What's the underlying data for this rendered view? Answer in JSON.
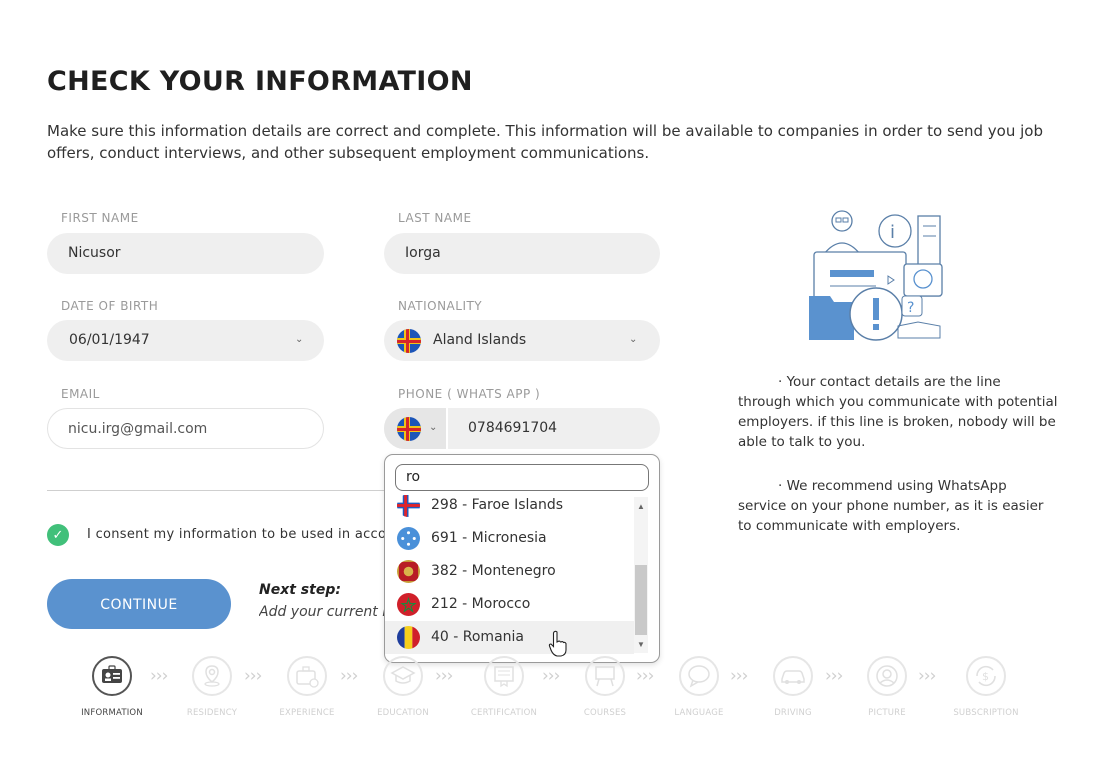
{
  "page": {
    "title": "CHECK YOUR INFORMATION",
    "intro": "Make sure this information details are correct and complete. This information will be available to companies in order to send you job offers, conduct interviews, and other subsequent employment communications."
  },
  "form": {
    "first_name": {
      "label": "FIRST NAME",
      "value": "Nicusor"
    },
    "last_name": {
      "label": "LAST NAME",
      "value": "Iorga"
    },
    "dob": {
      "label": "DATE OF BIRTH",
      "value": "06/01/1947"
    },
    "nationality": {
      "label": "NATIONALITY",
      "value": "Aland Islands"
    },
    "email": {
      "label": "EMAIL",
      "value": "nicu.irg@gmail.com"
    },
    "phone": {
      "label": "PHONE ( WHATS APP )",
      "value": "0784691704"
    },
    "consent": "I consent my information to be used in accordance",
    "continue_label": "CONTINUE",
    "next_step_title": "Next step:",
    "next_step_text": "Add your current residency"
  },
  "country_dropdown": {
    "search_value": "ro",
    "items": [
      {
        "label": "298 - Faroe Islands",
        "flag": "faroe-flag"
      },
      {
        "label": "691 - Micronesia",
        "flag": "micronesia-flag"
      },
      {
        "label": "382 - Montenegro",
        "flag": "montenegro-flag"
      },
      {
        "label": "212 - Morocco",
        "flag": "morocco-flag"
      },
      {
        "label": "40 - Romania",
        "flag": "romania-flag"
      }
    ]
  },
  "sidebar": {
    "note1": "· Your contact details are the line through which you communicate with potential employers. if this line is broken, nobody will be able to talk to you.",
    "note2": "· We recommend using WhatsApp service on your phone number, as it is easier to communicate with employers."
  },
  "steps": [
    {
      "label": "INFORMATION",
      "icon": "id-card-icon",
      "active": true
    },
    {
      "label": "RESIDENCY",
      "icon": "location-pin-icon",
      "active": false
    },
    {
      "label": "EXPERIENCE",
      "icon": "briefcase-icon",
      "active": false
    },
    {
      "label": "EDUCATION",
      "icon": "graduation-cap-icon",
      "active": false
    },
    {
      "label": "CERTIFICATION",
      "icon": "certificate-icon",
      "active": false
    },
    {
      "label": "COURSES",
      "icon": "easel-icon",
      "active": false
    },
    {
      "label": "LANGUAGE",
      "icon": "speech-bubble-icon",
      "active": false
    },
    {
      "label": "DRIVING",
      "icon": "car-icon",
      "active": false
    },
    {
      "label": "PICTURE",
      "icon": "portrait-icon",
      "active": false
    },
    {
      "label": "SUBSCRIPTION",
      "icon": "subscription-icon",
      "active": false
    }
  ],
  "colors": {
    "accent": "#5a92cf",
    "check": "#41c07a",
    "field_bg": "#efefef"
  }
}
